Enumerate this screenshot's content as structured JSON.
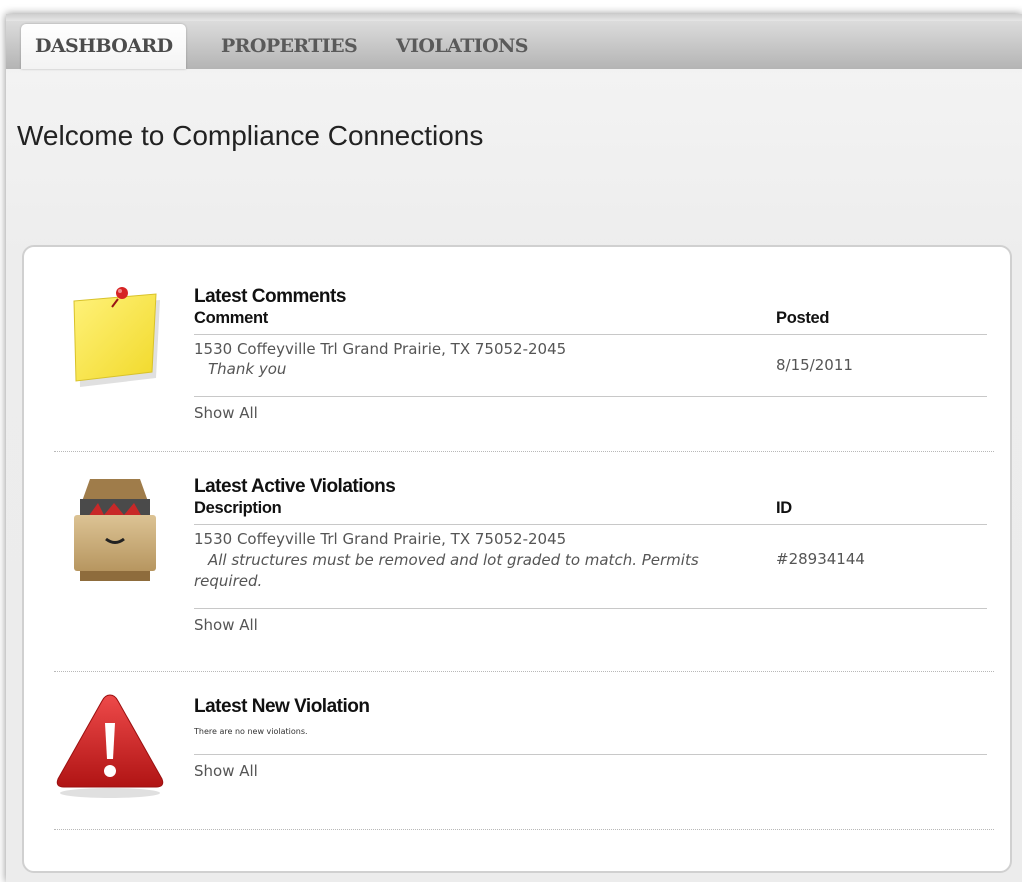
{
  "tabs": [
    {
      "label": "DASHBOARD",
      "active": true
    },
    {
      "label": "PROPERTIES",
      "active": false
    },
    {
      "label": "VIOLATIONS",
      "active": false
    }
  ],
  "page_title": "Welcome to Compliance Connections",
  "comments": {
    "title": "Latest Comments",
    "columns": [
      "Comment",
      "Posted"
    ],
    "rows": [
      {
        "address": "1530 Coffeyville Trl Grand Prairie, TX 75052-2045",
        "text": "Thank you",
        "posted": "8/15/2011"
      }
    ],
    "show_all": "Show All",
    "icon": "sticky-note-icon"
  },
  "active_violations": {
    "title": "Latest Active Violations",
    "columns": [
      "Description",
      "ID"
    ],
    "rows": [
      {
        "address": "1530 Coffeyville Trl Grand Prairie, TX 75052-2045",
        "text": "All structures must be removed and lot graded to match. Permits required.",
        "id": "#28934144"
      }
    ],
    "show_all": "Show All",
    "icon": "drawer-icon"
  },
  "new_violation": {
    "title": "Latest New Violation",
    "empty_text": "There are no new violations.",
    "show_all": "Show All",
    "icon": "warning-icon"
  },
  "colors": {
    "tab_bar": "#b4b4b4",
    "panel_border": "#d0d0d0",
    "warning_red": "#cc1f1f",
    "note_yellow": "#f7e33a"
  }
}
